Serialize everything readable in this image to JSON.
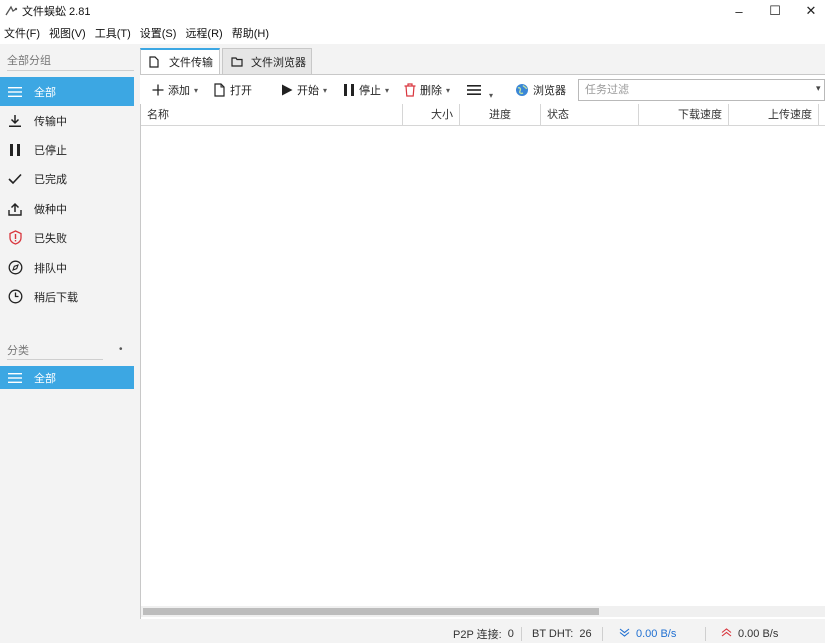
{
  "window": {
    "title": "文件蜈蚣 2.81",
    "minimize": "–",
    "maximize": "☐",
    "close": "✕"
  },
  "menu": [
    "文件(F)",
    "视图(V)",
    "工具(T)",
    "设置(S)",
    "远程(R)",
    "帮助(H)"
  ],
  "sidebar": {
    "section_all": "全部分组",
    "items": [
      {
        "label": "全部",
        "icon": "list-icon",
        "active": true
      },
      {
        "label": "传输中",
        "icon": "download-icon",
        "active": false
      },
      {
        "label": "已停止",
        "icon": "pause-icon",
        "active": false
      },
      {
        "label": "已完成",
        "icon": "check-icon",
        "active": false
      },
      {
        "label": "做种中",
        "icon": "upload-icon",
        "active": false
      },
      {
        "label": "已失败",
        "icon": "error-icon",
        "active": false
      },
      {
        "label": "排队中",
        "icon": "queue-icon",
        "active": false
      },
      {
        "label": "稍后下载",
        "icon": "clock-icon",
        "active": false
      }
    ],
    "section_category": "分类",
    "category_items": [
      {
        "label": "全部",
        "icon": "list-icon",
        "active": true
      }
    ]
  },
  "tabs": [
    {
      "label": "文件传输",
      "icon": "file-icon",
      "active": true
    },
    {
      "label": "文件浏览器",
      "icon": "folder-icon",
      "active": false
    }
  ],
  "toolbar": {
    "add": "添加",
    "open": "打开",
    "start": "开始",
    "stop": "停止",
    "delete": "删除",
    "browser": "浏览器",
    "filter_placeholder": "任务过滤"
  },
  "table": {
    "columns": [
      "名称",
      "大小",
      "进度",
      "状态",
      "下载速度",
      "上传速度"
    ],
    "rows": []
  },
  "status": {
    "p2p_label": "P2P 连接:",
    "p2p_value": "0",
    "dht_label": "BT DHT:",
    "dht_value": "26",
    "down_speed": "0.00 B/s",
    "up_speed": "0.00 B/s"
  },
  "colors": {
    "accent": "#3ca7e3",
    "delete_red": "#d9363e",
    "down_blue": "#1f6fd1",
    "up_red": "#d9363e"
  }
}
